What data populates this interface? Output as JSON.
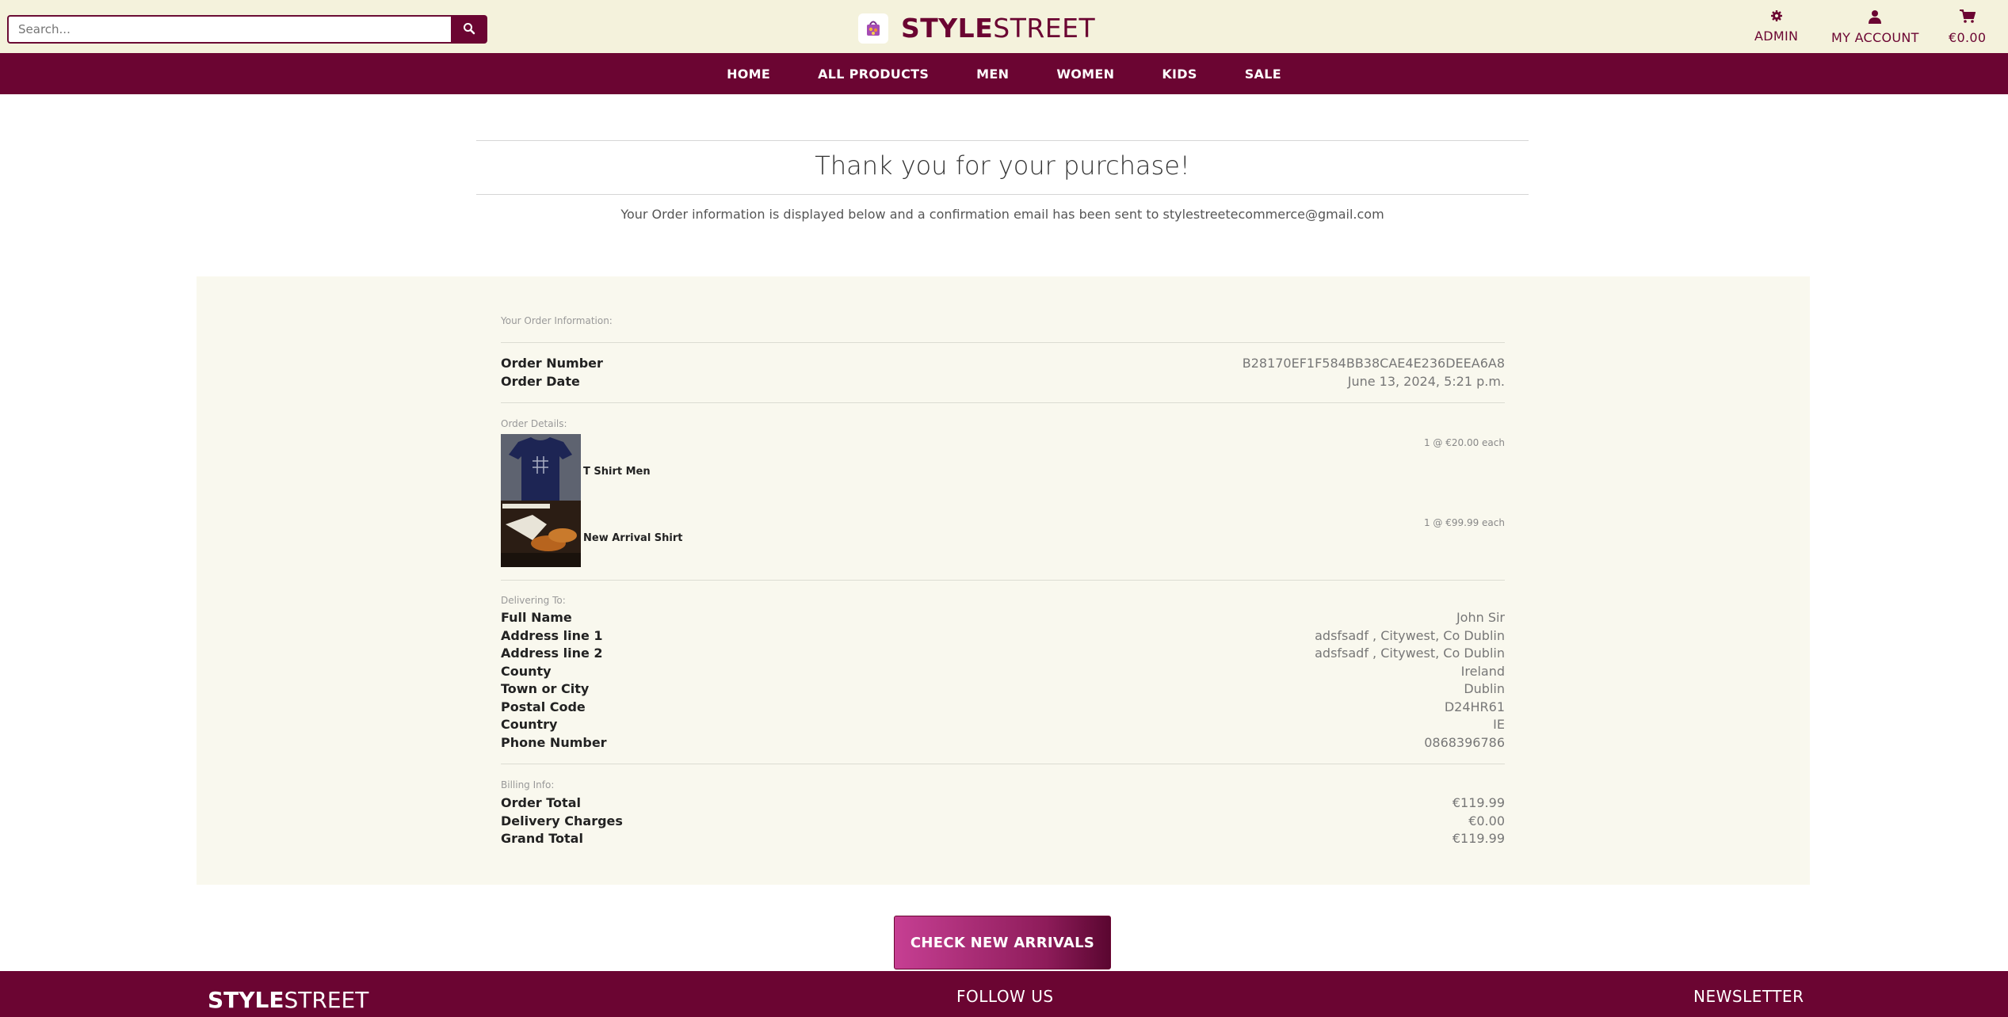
{
  "header": {
    "search_placeholder": "Search...",
    "logo_bold": "STYLE",
    "logo_light": "STREET",
    "admin_label": "ADMIN",
    "account_label": "MY ACCOUNT",
    "cart_label": "€0.00"
  },
  "nav": {
    "items": [
      "HOME",
      "ALL PRODUCTS",
      "MEN",
      "WOMEN",
      "KIDS",
      "SALE"
    ]
  },
  "confirmation": {
    "title": "Thank you for your purchase!",
    "subtitle": "Your Order information is displayed below and a confirmation email has been sent to stylestreetecommerce@gmail.com"
  },
  "order": {
    "info_label": "Your Order Information:",
    "number_label": "Order Number",
    "number_value": "B28170EF1F584BB38CAE4E236DEEA6A8",
    "date_label": "Order Date",
    "date_value": "June 13, 2024, 5:21 p.m.",
    "details_label": "Order Details:",
    "items": [
      {
        "name": "T Shirt Men",
        "price": "1 @ €20.00 each",
        "image_icon": "navy-tshirt-image"
      },
      {
        "name": "New Arrival Shirt",
        "price": "1 @ €99.99 each",
        "image_icon": "shoes-shirt-image"
      }
    ],
    "delivery_label": "Delivering To:",
    "delivery": [
      {
        "k": "Full Name",
        "v": "John Sir"
      },
      {
        "k": "Address line 1",
        "v": "adsfsadf , Citywest, Co Dublin"
      },
      {
        "k": "Address line 2",
        "v": "adsfsadf , Citywest, Co Dublin"
      },
      {
        "k": "County",
        "v": "Ireland"
      },
      {
        "k": "Town or City",
        "v": "Dublin"
      },
      {
        "k": "Postal Code",
        "v": "D24HR61"
      },
      {
        "k": "Country",
        "v": "IE"
      },
      {
        "k": "Phone Number",
        "v": "0868396786"
      }
    ],
    "billing_label": "Billing Info:",
    "billing": [
      {
        "k": "Order Total",
        "v": "€119.99"
      },
      {
        "k": "Delivery Charges",
        "v": "€0.00"
      },
      {
        "k": "Grand Total",
        "v": "€119.99"
      }
    ]
  },
  "cta": {
    "label": "CHECK NEW ARRIVALS"
  },
  "footer": {
    "logo_bold": "STYLE",
    "logo_light": "STREET",
    "follow": "FOLLOW US",
    "newsletter": "NEWSLETTER"
  },
  "colors": {
    "brand": "#6b0532",
    "header_bg": "#f4f2dc",
    "panel_bg": "#f9f8ee"
  }
}
